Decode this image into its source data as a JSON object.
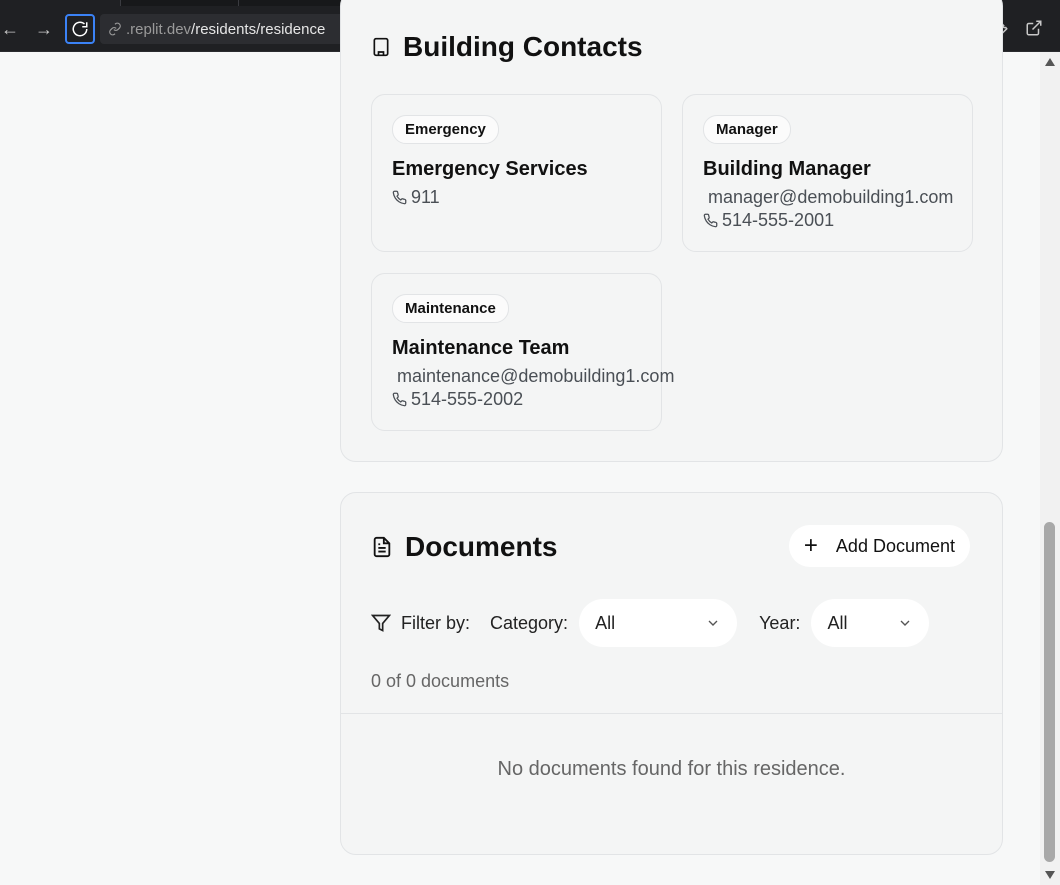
{
  "browser": {
    "url_host": ".replit.dev",
    "url_path": "/residents/residence"
  },
  "contacts": {
    "title": "Building Contacts",
    "items": [
      {
        "badge": "Emergency",
        "name": "Emergency Services",
        "email": "",
        "phone": "911"
      },
      {
        "badge": "Manager",
        "name": "Building Manager",
        "email": "manager@demobuilding1.com",
        "phone": "514-555-2001"
      },
      {
        "badge": "Maintenance",
        "name": "Maintenance Team",
        "email": "maintenance@demobuilding1.com",
        "phone": "514-555-2002"
      }
    ]
  },
  "documents": {
    "title": "Documents",
    "add_label": "Add Document",
    "filter_label": "Filter by:",
    "category_label": "Category:",
    "category_value": "All",
    "year_label": "Year:",
    "year_value": "All",
    "count_text": "0 of 0 documents",
    "empty_text": "No documents found for this residence."
  }
}
